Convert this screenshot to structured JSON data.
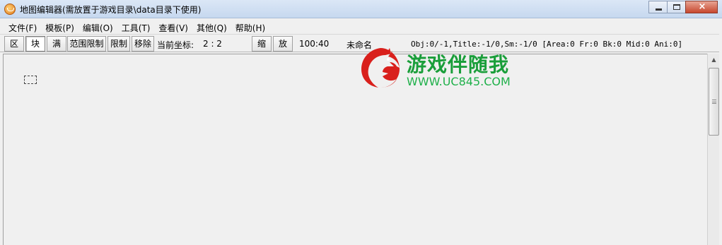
{
  "window": {
    "title": "地图编辑器(需放置于游戏目录\\data目录下使用)",
    "icon": "app-orange-icon",
    "controls": {
      "minimize": "minimize-icon",
      "maximize": "maximize-icon",
      "close": "×"
    }
  },
  "menu": [
    {
      "label": "文件(F)"
    },
    {
      "label": "模板(P)"
    },
    {
      "label": "编辑(O)"
    },
    {
      "label": "工具(T)"
    },
    {
      "label": "查看(V)"
    },
    {
      "label": "其他(Q)"
    },
    {
      "label": "帮助(H)"
    }
  ],
  "toolbar": {
    "btn_qu": "区",
    "btn_kuai": "块",
    "btn_man": "满",
    "btn_fanwei": "范围限制",
    "btn_xianzhi": "限制",
    "btn_yichu": "移除",
    "coord_label": "当前坐标:",
    "coord_value": "2 : 2",
    "btn_suo": "缩",
    "btn_fang": "放",
    "size": "100:40",
    "filename": "未命名",
    "status": "Obj:0/-1,Title:-1/0,Sm:-1/0 [Area:0 Fr:0 Bk:0 Mid:0 Ani:0]"
  },
  "watermark": {
    "name": "游戏伴随我",
    "url": "WWW.UC845.COM",
    "color": "#1a9e3a",
    "icon": "red-dragon-logo"
  }
}
